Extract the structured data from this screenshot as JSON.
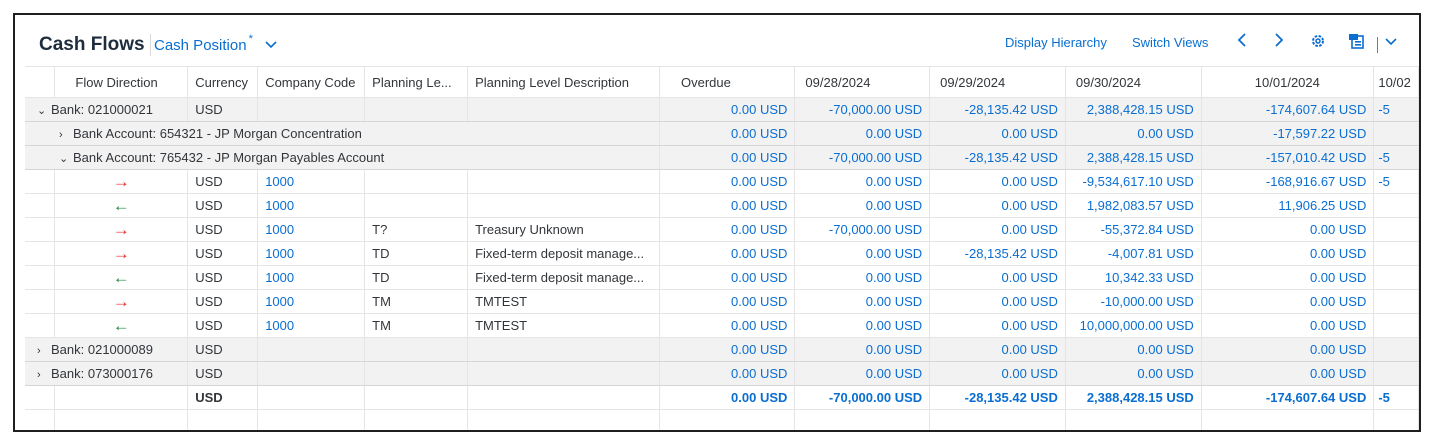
{
  "toolbar": {
    "title": "Cash Flows",
    "variant_name": "Cash Position",
    "variant_modified": "*",
    "variant_chevron": "⌄",
    "display_hierarchy": "Display Hierarchy",
    "switch_views": "Switch Views",
    "prev_icon": "chevron-left-icon",
    "next_icon": "chevron-right-icon",
    "settings_icon": "gear-icon",
    "export_icon": "export-icon"
  },
  "columns": [
    "Flow Direction",
    "Currency",
    "Company Code",
    "Planning Le...",
    "Planning Level Description",
    "Overdue",
    "09/28/2024",
    "09/29/2024",
    "09/30/2024",
    "10/01/2024",
    "10/02"
  ],
  "rows": [
    {
      "type": "group",
      "caret": "⌄",
      "label": "Bank: 021000021",
      "currency": "USD",
      "values": [
        "0.00 USD",
        "-70,000.00 USD",
        "-28,135.42 USD",
        "2,388,428.15 USD",
        "-174,607.64 USD",
        "-5"
      ]
    },
    {
      "type": "sub",
      "caret": "›",
      "label": "Bank Account: 654321 - JP Morgan Concentration",
      "values": [
        "0.00 USD",
        "0.00 USD",
        "0.00 USD",
        "0.00 USD",
        "-17,597.22 USD",
        ""
      ]
    },
    {
      "type": "sub",
      "caret": "⌄",
      "label": "Bank Account: 765432 - JP Morgan Payables Account",
      "values": [
        "0.00 USD",
        "-70,000.00 USD",
        "-28,135.42 USD",
        "2,388,428.15 USD",
        "-157,010.42 USD",
        "-5"
      ]
    },
    {
      "type": "item",
      "dir": "out",
      "arrow": "→",
      "currency": "USD",
      "company": "1000",
      "level": "",
      "desc": "",
      "values": [
        "0.00 USD",
        "0.00 USD",
        "0.00 USD",
        "-9,534,617.10 USD",
        "-168,916.67 USD",
        "-5"
      ]
    },
    {
      "type": "item",
      "dir": "in",
      "arrow": "←",
      "currency": "USD",
      "company": "1000",
      "level": "",
      "desc": "",
      "values": [
        "0.00 USD",
        "0.00 USD",
        "0.00 USD",
        "1,982,083.57 USD",
        "11,906.25 USD",
        ""
      ]
    },
    {
      "type": "item",
      "dir": "out",
      "arrow": "→",
      "currency": "USD",
      "company": "1000",
      "level": "T?",
      "desc": "Treasury Unknown",
      "values": [
        "0.00 USD",
        "-70,000.00 USD",
        "0.00 USD",
        "-55,372.84 USD",
        "0.00 USD",
        ""
      ]
    },
    {
      "type": "item",
      "dir": "out",
      "arrow": "→",
      "currency": "USD",
      "company": "1000",
      "level": "TD",
      "desc": "Fixed-term deposit manage...",
      "values": [
        "0.00 USD",
        "0.00 USD",
        "-28,135.42 USD",
        "-4,007.81 USD",
        "0.00 USD",
        ""
      ]
    },
    {
      "type": "item",
      "dir": "in",
      "arrow": "←",
      "currency": "USD",
      "company": "1000",
      "level": "TD",
      "desc": "Fixed-term deposit manage...",
      "values": [
        "0.00 USD",
        "0.00 USD",
        "0.00 USD",
        "10,342.33 USD",
        "0.00 USD",
        ""
      ]
    },
    {
      "type": "item",
      "dir": "out",
      "arrow": "→",
      "currency": "USD",
      "company": "1000",
      "level": "TM",
      "desc": "TMTEST",
      "values": [
        "0.00 USD",
        "0.00 USD",
        "0.00 USD",
        "-10,000.00 USD",
        "0.00 USD",
        ""
      ]
    },
    {
      "type": "item",
      "dir": "in",
      "arrow": "←",
      "currency": "USD",
      "company": "1000",
      "level": "TM",
      "desc": "TMTEST",
      "values": [
        "0.00 USD",
        "0.00 USD",
        "0.00 USD",
        "10,000,000.00 USD",
        "0.00 USD",
        ""
      ]
    },
    {
      "type": "group",
      "caret": "›",
      "label": "Bank: 021000089",
      "currency": "USD",
      "values": [
        "0.00 USD",
        "0.00 USD",
        "0.00 USD",
        "0.00 USD",
        "0.00 USD",
        ""
      ]
    },
    {
      "type": "group",
      "caret": "›",
      "label": "Bank: 073000176",
      "currency": "USD",
      "values": [
        "0.00 USD",
        "0.00 USD",
        "0.00 USD",
        "0.00 USD",
        "0.00 USD",
        ""
      ]
    },
    {
      "type": "total",
      "currency": "USD",
      "values": [
        "0.00 USD",
        "-70,000.00 USD",
        "-28,135.42 USD",
        "2,388,428.15 USD",
        "-174,607.64 USD",
        "-5"
      ]
    }
  ]
}
